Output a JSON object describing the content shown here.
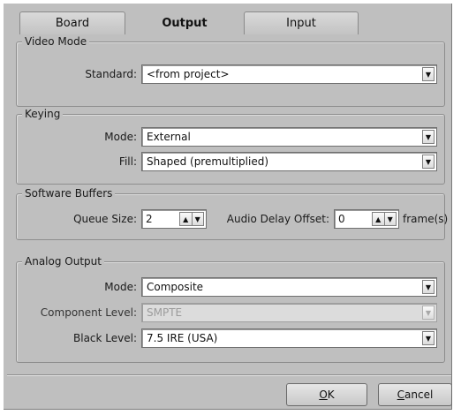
{
  "tabs": [
    {
      "label": "Board",
      "active": false
    },
    {
      "label": "Output",
      "active": true
    },
    {
      "label": "Input",
      "active": false
    }
  ],
  "video_mode": {
    "title": "Video Mode",
    "standard_label": "Standard:",
    "standard_value": "<from project>"
  },
  "keying": {
    "title": "Keying",
    "mode_label": "Mode:",
    "mode_value": "External",
    "fill_label": "Fill:",
    "fill_value": "Shaped (premultiplied)"
  },
  "software_buffers": {
    "title": "Software Buffers",
    "queue_size_label": "Queue Size:",
    "queue_size_value": "2",
    "audio_delay_label": "Audio Delay Offset:",
    "audio_delay_value": "0",
    "audio_delay_unit": "frame(s)"
  },
  "analog_output": {
    "title": "Analog Output",
    "mode_label": "Mode:",
    "mode_value": "Composite",
    "component_level_label": "Component Level:",
    "component_level_value": "SMPTE",
    "component_level_enabled": false,
    "black_level_label": "Black Level:",
    "black_level_value": "7.5 IRE (USA)"
  },
  "buttons": {
    "ok_mnemonic": "O",
    "ok_rest": "K",
    "cancel_mnemonic": "C",
    "cancel_rest": "ancel"
  },
  "icons": {
    "dropdown": "chevron-down-icon",
    "spin_up": "arrow-up-icon",
    "spin_down": "arrow-down-icon"
  },
  "colors": {
    "dialog_bg": "#bfbfbf",
    "field_bg": "#ffffff",
    "disabled_text": "#9b9b9b"
  }
}
